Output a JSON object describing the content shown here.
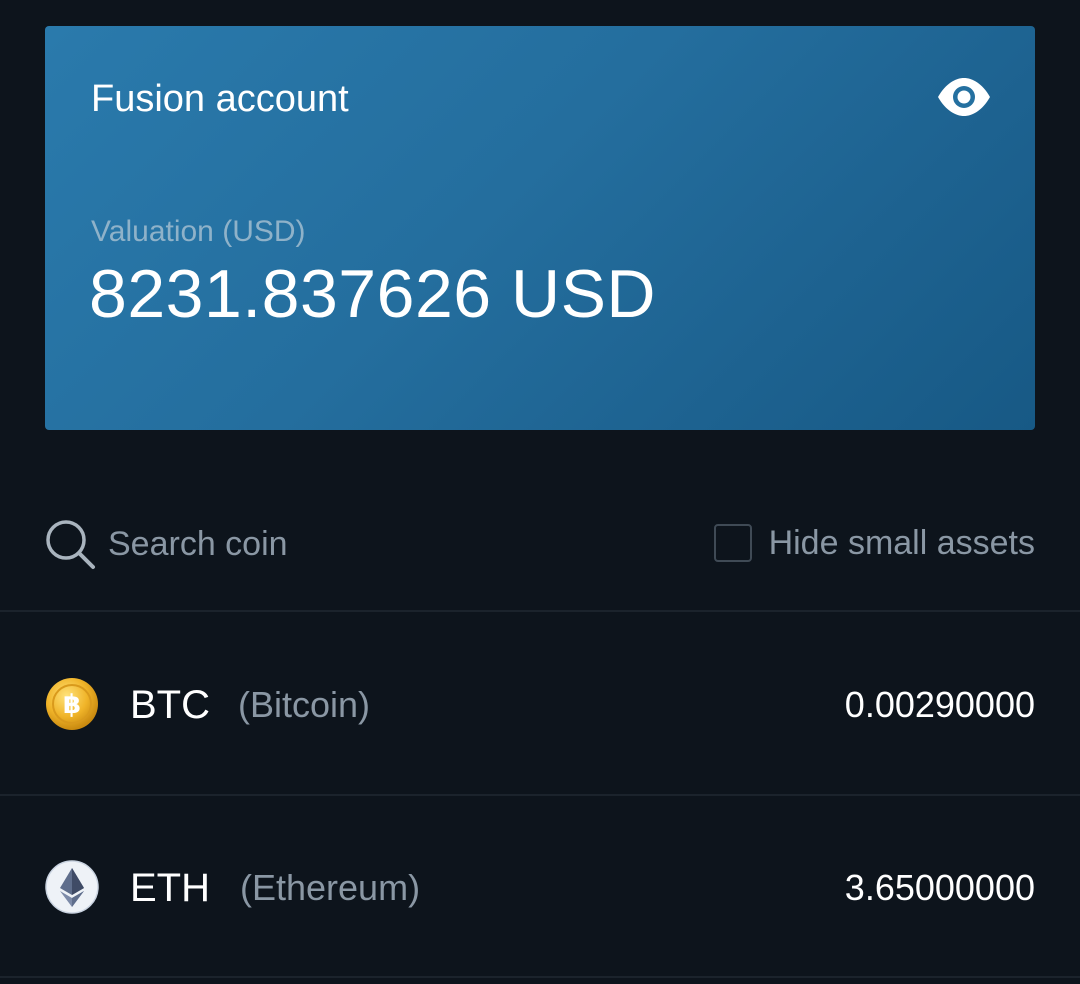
{
  "account": {
    "title": "Fusion account",
    "valuation_label": "Valuation (USD)",
    "valuation_value": "8231.837626 USD",
    "visibility_icon": "eye-icon"
  },
  "search": {
    "placeholder": "Search coin",
    "icon": "search-icon"
  },
  "filters": {
    "hide_small_assets_label": "Hide small assets",
    "hide_small_assets_checked": false
  },
  "coins": [
    {
      "symbol": "BTC",
      "name": "(Bitcoin)",
      "amount": "0.00290000",
      "icon": "bitcoin-icon",
      "color": "#f0b429"
    },
    {
      "symbol": "ETH",
      "name": "(Ethereum)",
      "amount": "3.65000000",
      "icon": "ethereum-icon",
      "color": "#5f6e8c"
    }
  ],
  "colors": {
    "background": "#0d141c",
    "card": "#246e9e",
    "muted_text": "#8a97a4",
    "divider": "#1b232c"
  }
}
